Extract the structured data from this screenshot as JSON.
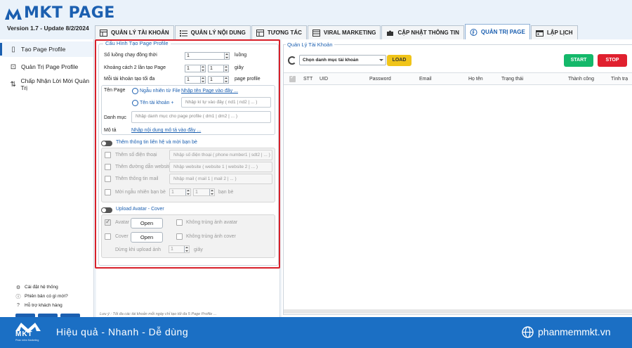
{
  "app": {
    "logo_text": "MKT PAGE",
    "version": "Version  1.7   -  Update  8/2/2024"
  },
  "tabs": [
    {
      "label": "QUẢN LÝ TÀI KHOẢN",
      "icon": "table-icon"
    },
    {
      "label": "QUẢN LÝ NỘI DUNG",
      "icon": "list-icon"
    },
    {
      "label": "TƯƠNG TÁC",
      "icon": "table-icon"
    },
    {
      "label": "VIRAL MARKETING",
      "icon": "grid-icon"
    },
    {
      "label": "CẬP NHẬT THÔNG TIN",
      "icon": "puzzle-icon"
    },
    {
      "label": "QUẢN TRỊ PAGE",
      "icon": "facebook-icon",
      "active": true
    },
    {
      "label": "LẬP LỊCH",
      "icon": "calendar-icon"
    }
  ],
  "sidebar": {
    "items": [
      {
        "label": "Tạo Page Profile",
        "icon": "page-icon",
        "active": true
      },
      {
        "label": "Quản Trị Page Profile",
        "icon": "admin-icon"
      },
      {
        "label": "Chấp Nhận Lời Mời Quản Trị",
        "icon": "transfer-icon"
      }
    ],
    "bottom": [
      {
        "label": "Cài đặt hệ thống",
        "icon": "gear-icon"
      },
      {
        "label": "Phiên bản có gì mới?",
        "icon": "info-icon"
      },
      {
        "label": "Hỗ trợ khách hàng",
        "icon": "help-icon"
      }
    ]
  },
  "config": {
    "legend": "Cấu Hình Tạo Page Profile",
    "threads_label": "Số luồng chạy đồng thời",
    "threads_value": "1",
    "threads_unit": "luồng",
    "interval_label": "Khoảng cách 2 lần tạo Page",
    "interval_from": "1",
    "interval_to": "1",
    "interval_unit": "giây",
    "max_label": "Mỗi tài khoản tạo tối đa",
    "max_from": "1",
    "max_to": "1",
    "max_unit": "page profile",
    "page_name_label": "Tên Page",
    "random_file_label": "Ngẫu nhiên từ File",
    "random_file_link": "Nhập tên Page vào đây ...",
    "acct_name_label": "Tên tài khoản +",
    "acct_name_placeholder": "Nhập kí tự vào đây ( nd1 | nd2 | ... )",
    "category_label": "Danh mục",
    "category_placeholder": "Nhập danh mục cho page profile ( dm1 | dm2 | ... )",
    "desc_label": "Mô tả",
    "desc_link": "Nhập nội dung mô tả vào đây ...",
    "contact_title": "Thêm thông tin liên hệ và mời bạn bè",
    "phone_label": "Thêm số điện thoại",
    "phone_placeholder": "Nhập số điện thoại ( phone number1 | sdt2 | ... )",
    "website_label": "Thêm đường dẫn website",
    "website_placeholder": "Nhập website ( website 1 | website 2 | ... )",
    "mail_label": "Thêm thông tin mail",
    "mail_placeholder": "Nhập mail ( mail 1 | mail 2 | ... )",
    "invite_label": "Mời ngẫu nhiên bạn bè",
    "invite_from": "1",
    "invite_to": "1",
    "invite_unit": "bạn bè",
    "upload_title": "Upload Avatar - Cover",
    "avatar_label": "Avatar",
    "avatar_button": "Open",
    "no_dup_avatar": "Không trùng ảnh avatar",
    "cover_label": "Cover",
    "cover_button": "Open",
    "no_dup_cover": "Không trùng ảnh cover",
    "pause_label": "Dừng khi upload ảnh",
    "pause_value": "1",
    "pause_unit": "giây",
    "note": "Lưu ý : Tối đa các tài khoản mỗi ngày chỉ tạo tối đa 5 Page Profile ..."
  },
  "accounts": {
    "legend": "Quản Lý Tài Khoản",
    "select_value": "Chọn danh mục tài khoản",
    "load_label": "LOAD",
    "start_label": "START",
    "stop_label": "STOP",
    "columns": [
      "STT",
      "UID",
      "Password",
      "Email",
      "Họ tên",
      "Trạng thái",
      "Thành công",
      "Tình trạ"
    ]
  },
  "footer": {
    "logo_text": "MKT",
    "logo_sub": "Phần mềm Marketing",
    "slogan": "Hiệu quả - Nhanh  - Dễ dùng",
    "site": "phanmemmkt.vn"
  },
  "colors": {
    "brand": "#1b5fb0",
    "highlight": "#d8202a",
    "start": "#14b86a",
    "stop": "#e0202e",
    "load": "#f0c419",
    "footer": "#1b6fc4"
  }
}
